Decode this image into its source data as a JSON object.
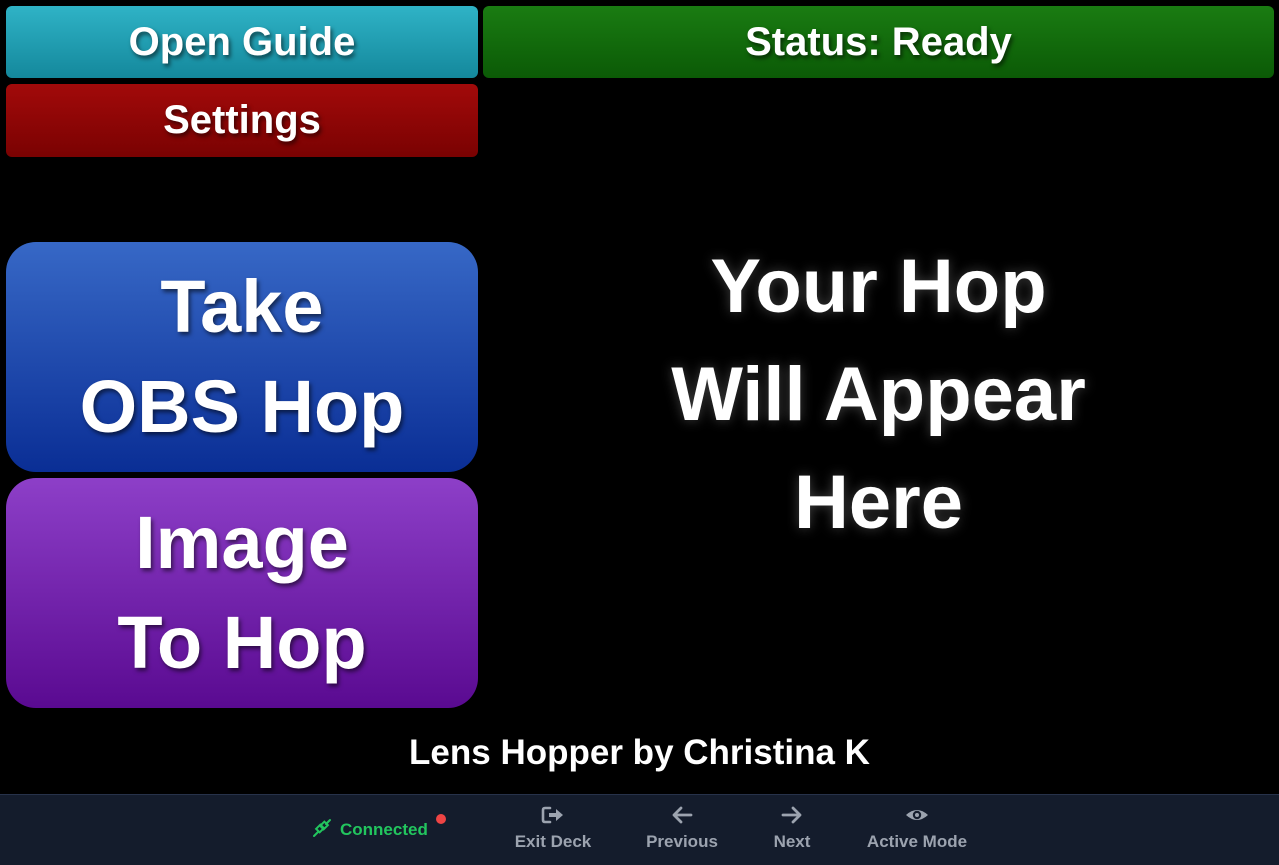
{
  "header": {
    "open_guide_label": "Open Guide",
    "status_label": "Status: Ready",
    "settings_label": "Settings"
  },
  "actions": {
    "take_hop_line1": "Take",
    "take_hop_line2": "OBS Hop",
    "image_hop_line1": "Image",
    "image_hop_line2": "To Hop"
  },
  "preview": {
    "line1": "Your Hop",
    "line2": "Will Appear",
    "line3": "Here"
  },
  "credit": "Lens Hopper by Christina K",
  "bottom_bar": {
    "connection_label": "Connected",
    "exit_label": "Exit Deck",
    "previous_label": "Previous",
    "next_label": "Next",
    "active_mode_label": "Active Mode"
  },
  "colors": {
    "open_guide": "#1fa0b4",
    "status": "#127009",
    "settings": "#8e0505",
    "take_hop": "#2049ad",
    "image_hop": "#7325ad",
    "connected": "#22c55e",
    "bottom_bar": "#141c2c"
  },
  "icons": {
    "connection": "plug-icon",
    "connection_dot": "status-dot-icon",
    "exit": "sign-out-icon",
    "previous": "arrow-left-icon",
    "next": "arrow-right-icon",
    "active_mode": "eye-icon"
  }
}
